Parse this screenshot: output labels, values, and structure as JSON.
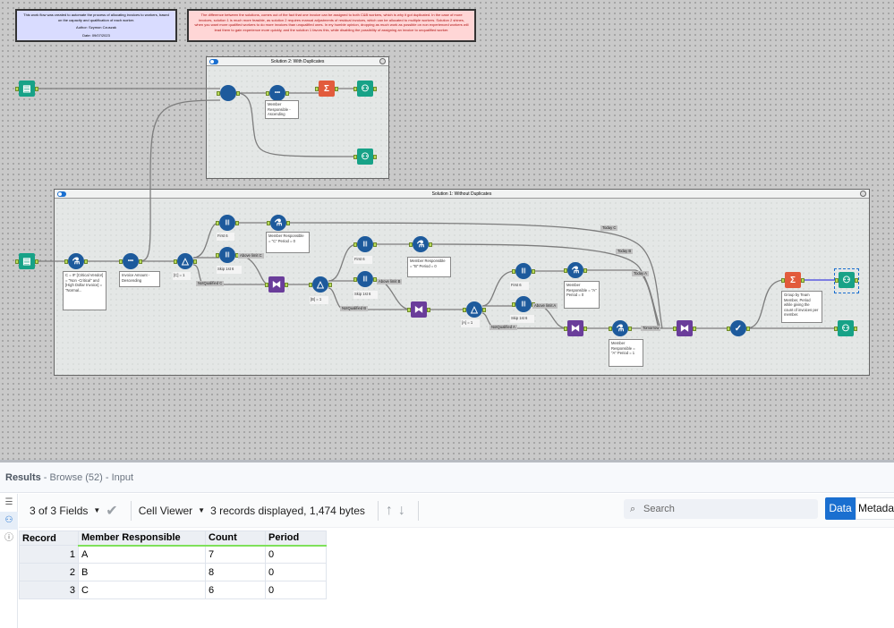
{
  "comments": {
    "info": {
      "lines": [
        "This work flow was created to automate the process of allocating invoices to workers, based on the capacity and qualification of each worker.",
        "Author: Szymon Czuszak",
        "Date: 09/07/2023"
      ],
      "color": "#d9dcff"
    },
    "difference": {
      "text": "The difference between the solutions, comes out of the fact that one invoice can be assigned to both C&B workers, which is why it got duplicated. In the case of more invoices, solution 1 is much more feasible, as solution 2 requires manual adjustments of residual invoices, which can be allocated to multiple workers. Solution 2 shines, when you want more qualified workers to do more invoices than unqualified ones. In my humble opinion, dropping as much work as possible on non experienced workers will lead them to gain experience more quickly, and the solution 1 favors this, while disabling the possibility of assigning an invoice to unqualified worker.",
      "color": "#ffd6d6"
    }
  },
  "containers": {
    "solution2": {
      "title": "Solution 2: With Duplicates"
    },
    "solution1": {
      "title": "Solution 1: Without Duplicates"
    }
  },
  "annotations": {
    "s2_sort": "Member Responsible - Ascending",
    "s1_formula": "C = IF [Critical Vendor] = \"Non -Critical\" and [High Dollar Invoice] = \"Normal...",
    "s1_sort": "Invoice Amount - Descending",
    "filter_c": "[C] = 1",
    "first_c": "First 6",
    "formula_c": "Member Responsible = \"C\" Period = 0",
    "skip_c": "Skip 1st 6",
    "filter_b": "[B] = 1",
    "first_b": "First 6",
    "formula_b": "Member Responsible = \"B\" Period = 0",
    "skip_b": "Skip 1st 6",
    "filter_a": "[A] = 1",
    "first_a": "First 6",
    "formula_a0": "Member Responsible = \"A\" Period = 0",
    "skip_a": "Skip 1st 6",
    "formula_a1": "Member Responsible = \"A\" Period = 1",
    "summarize": "Group by Team Member, Period while giving the count of invoices per member."
  },
  "wire_labels": {
    "above_c": "Above limit C",
    "notq_c": "NotQualified C",
    "above_b": "Above limit B",
    "notq_b": "NotQualified B",
    "above_a": "Above limit A",
    "notq_a": "NotQualified A",
    "today_c": "Today C",
    "today_b": "Today B",
    "today_a": "Today A",
    "tomorrow": "Tomorrow"
  },
  "results": {
    "title": "Results",
    "subtitle": " - Browse (52) - Input",
    "fields": "3 of 3 Fields",
    "cell_viewer": "Cell Viewer",
    "info": "3 records displayed, 1,474 bytes",
    "search_placeholder": "Search",
    "data_btn": "Data",
    "metadata_btn": "Metadata",
    "columns": [
      "Record",
      "Member Responsible",
      "Count",
      "Period"
    ],
    "rows": [
      [
        "1",
        "A",
        "7",
        "0"
      ],
      [
        "2",
        "B",
        "8",
        "0"
      ],
      [
        "3",
        "C",
        "6",
        "0"
      ]
    ]
  },
  "colors": {
    "accent": "#1a6fd0",
    "tool_blue": "#1d5a9c",
    "join": "#6a3d9a",
    "summarize": "#e25b3c",
    "browse": "#17a287"
  }
}
